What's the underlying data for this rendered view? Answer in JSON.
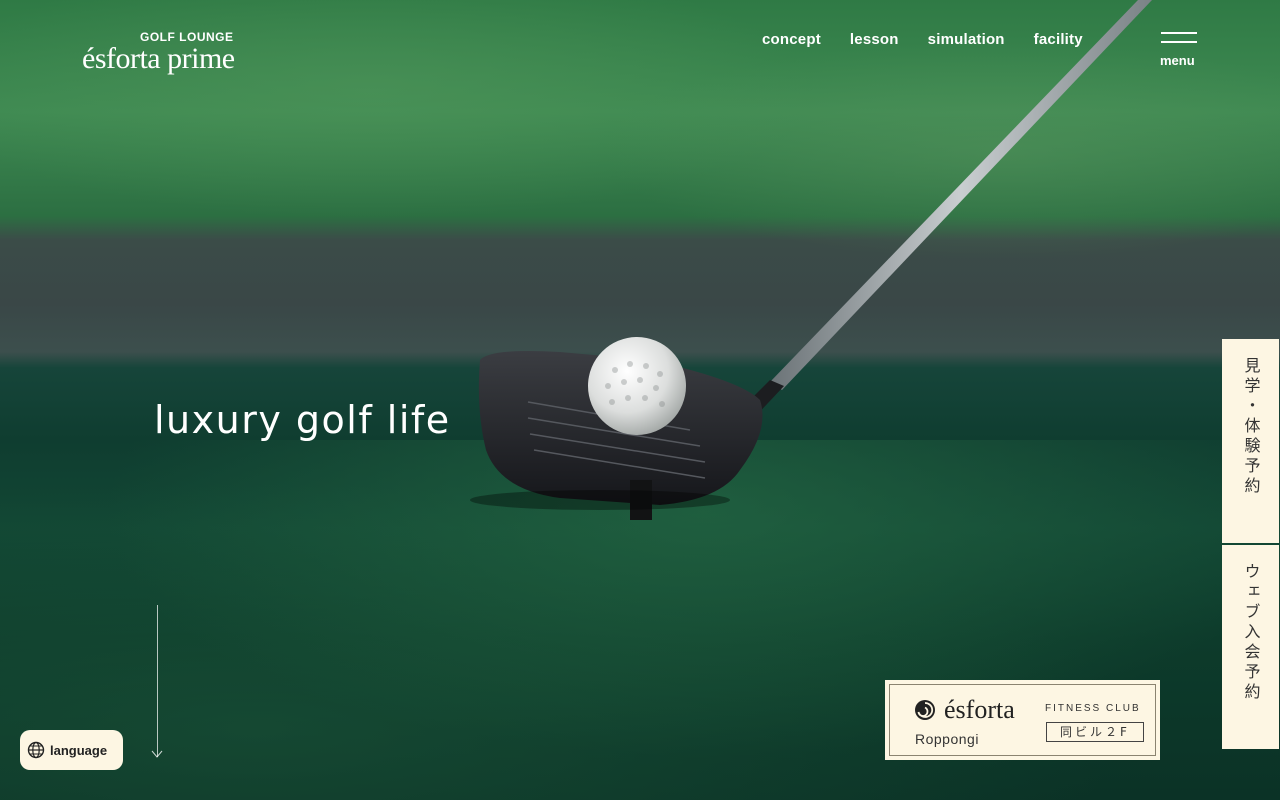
{
  "header": {
    "logo_sub": "GOLF LOUNGE",
    "logo_main": "ésforta prime",
    "nav": [
      {
        "label": "concept"
      },
      {
        "label": "lesson"
      },
      {
        "label": "simulation"
      },
      {
        "label": "facility"
      }
    ],
    "menu_label": "menu"
  },
  "hero": {
    "tagline": "luxury golf life"
  },
  "side_tabs": [
    {
      "label": "見学・体験予約"
    },
    {
      "label": "ウェブ入会予約"
    }
  ],
  "language_button": {
    "label": "language",
    "icon": "globe-icon"
  },
  "badge": {
    "brand": "ésforta",
    "city": "Roppongi",
    "club": "FITNESS CLUB",
    "floor": "同ビル２F"
  },
  "colors": {
    "cream": "#fdf6e3",
    "text_dark": "#222222",
    "turf_green": "#124734"
  }
}
